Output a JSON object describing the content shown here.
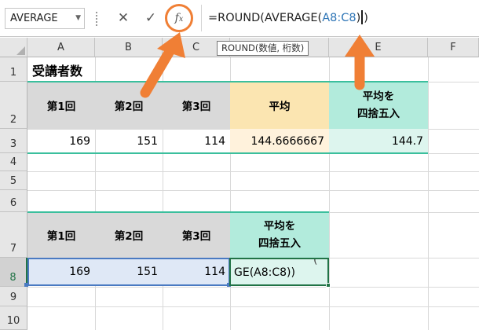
{
  "formula_bar": {
    "name_box": "AVERAGE",
    "formula_prefix": "=ROUND(AVERAGE(",
    "formula_ref": "A8:C8",
    "formula_suffix": ")",
    "formula_tail": ")",
    "tooltip": "ROUND(数値, 桁数)",
    "icons": [
      "cancel-icon",
      "enter-icon",
      "fx-icon"
    ]
  },
  "columns": [
    "A",
    "B",
    "C",
    "D",
    "E",
    "F"
  ],
  "rows": [
    "1",
    "2",
    "3",
    "4",
    "5",
    "6",
    "7",
    "8",
    "9",
    "10"
  ],
  "table1": {
    "title": "受講者数",
    "headers": [
      "第1回",
      "第2回",
      "第3回",
      "平均",
      "平均を\n四捨五入"
    ],
    "values": [
      "169",
      "151",
      "114",
      "144.6666667",
      "144.7"
    ]
  },
  "table2": {
    "headers": [
      "第1回",
      "第2回",
      "第3回",
      "平均を\n四捨五入"
    ],
    "values": [
      "169",
      "151",
      "114"
    ],
    "editing_text": "GE(A8:C8))",
    "editing_text_prev": "("
  },
  "colors": {
    "accent_orange": "#f07f35",
    "header_gray": "#d9d9d9",
    "header_yellow": "#fbe5b1",
    "header_teal": "#b2ebdc",
    "excel_green": "#217346",
    "selection_blue": "#4a7ac2"
  }
}
